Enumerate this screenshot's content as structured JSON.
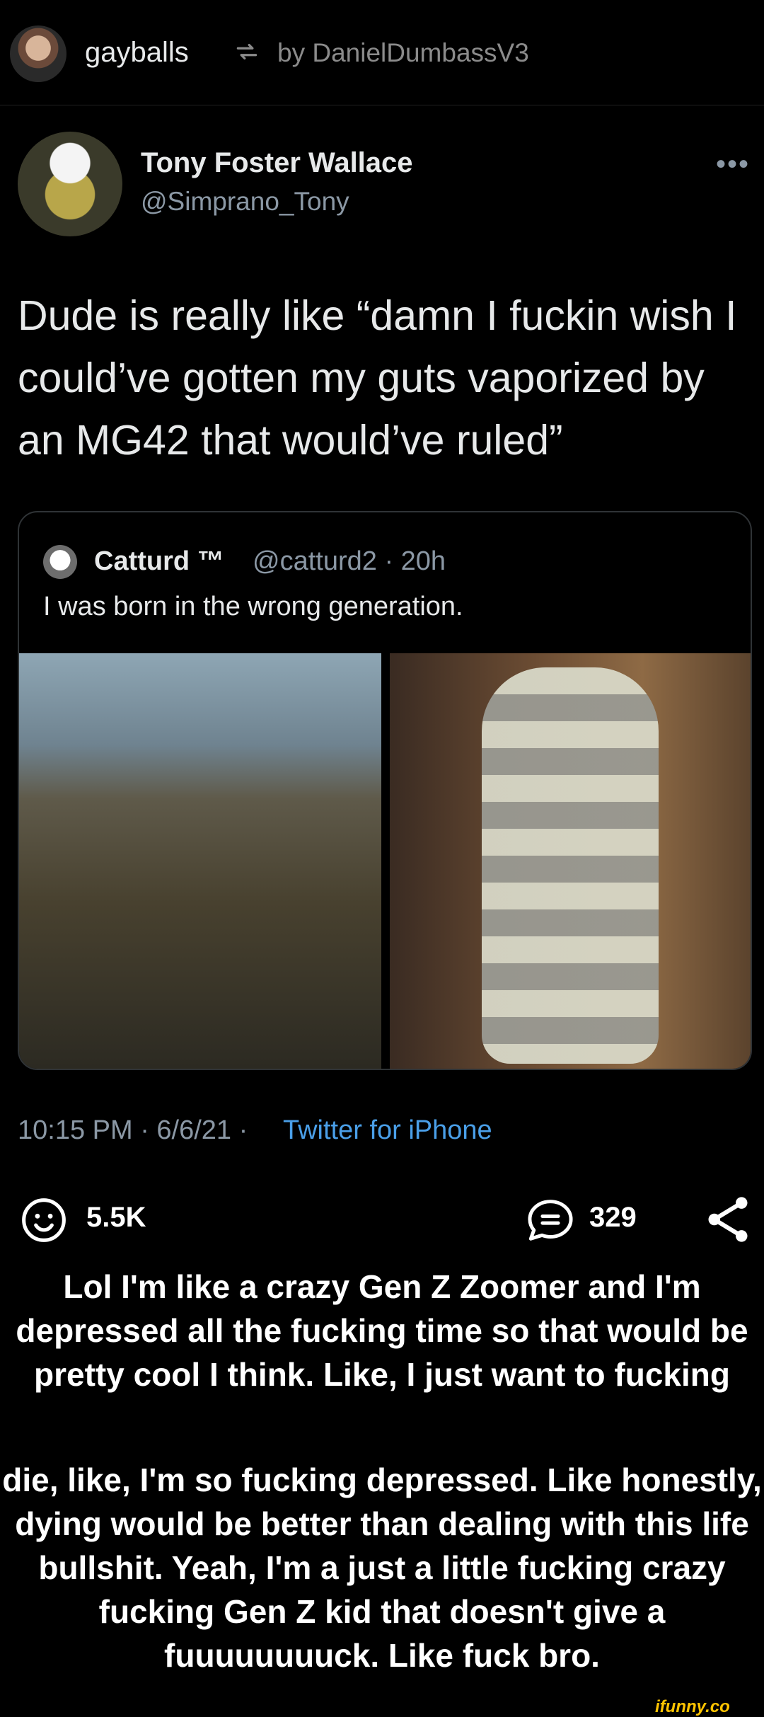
{
  "header": {
    "username": "gayballs",
    "by_text": "by DanielDumbassV3"
  },
  "tweet": {
    "author_name": "Tony Foster Wallace",
    "author_handle": "@Simprano_Tony",
    "text": "Dude is really like “damn I fuckin wish I could’ve gotten my guts vaporized by an MG42 that would’ve ruled”",
    "timestamp": "10:15 PM · 6/6/21 ·",
    "source": "Twitter for iPhone"
  },
  "quote": {
    "author_name": "Catturd ™",
    "meta": "@catturd2 · 20h",
    "text": "I was born in the wrong generation."
  },
  "actions": {
    "reactions": "5.5K",
    "comments": "329"
  },
  "caption": {
    "part1": "Lol I'm like a crazy Gen Z Zoomer and I'm depressed all the fucking time so that would be pretty cool I think. Like, I just want to fucking",
    "part2": "die, like, I'm so fucking depressed. Like honestly, dying would be better than dealing with this life bullshit. Yeah, I'm a just a little fucking crazy fucking Gen Z kid that doesn't give a fuuuuuuuuck. Like fuck bro."
  },
  "watermark": "ifunny.co",
  "colors": {
    "background": "#000000",
    "link": "#4a9fe8",
    "muted": "#8b98a5",
    "watermark": "#ffc400"
  }
}
